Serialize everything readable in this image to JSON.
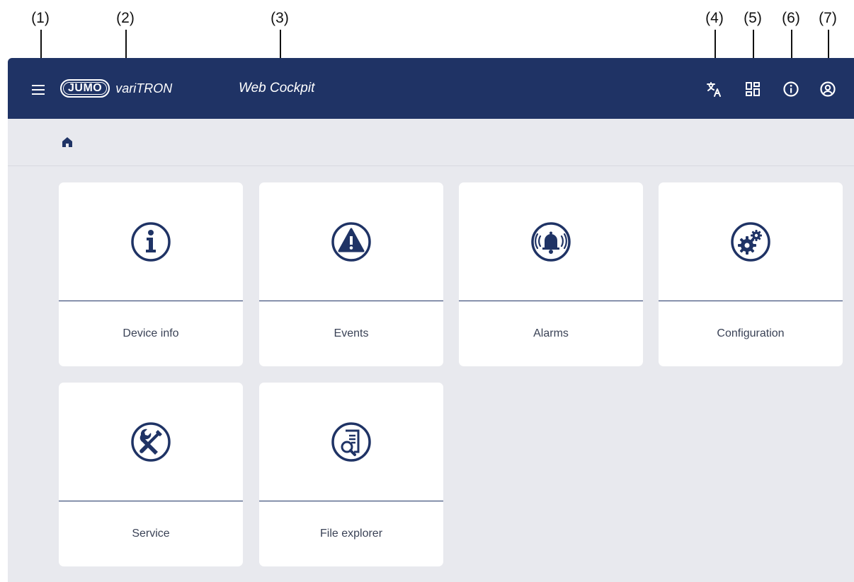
{
  "callouts": [
    "(1)",
    "(2)",
    "(3)",
    "(4)",
    "(5)",
    "(6)",
    "(7)"
  ],
  "header": {
    "brand": "JUMO",
    "product": "variTRON",
    "app_title": "Web Cockpit"
  },
  "colors": {
    "header_bg": "#1f3365",
    "page_bg": "#e8e9ee",
    "tile_bg": "#ffffff",
    "accent": "#1f3365"
  },
  "tiles": [
    {
      "label": "Device info",
      "icon": "info-circle-icon"
    },
    {
      "label": "Events",
      "icon": "warning-triangle-icon"
    },
    {
      "label": "Alarms",
      "icon": "alarm-bell-icon"
    },
    {
      "label": "Configuration",
      "icon": "gears-icon"
    },
    {
      "label": "Service",
      "icon": "wrench-screwdriver-icon"
    },
    {
      "label": "File explorer",
      "icon": "file-search-icon"
    }
  ],
  "toolbar_icons": [
    "translate-icon",
    "dashboard-icon",
    "info-icon",
    "account-icon"
  ]
}
